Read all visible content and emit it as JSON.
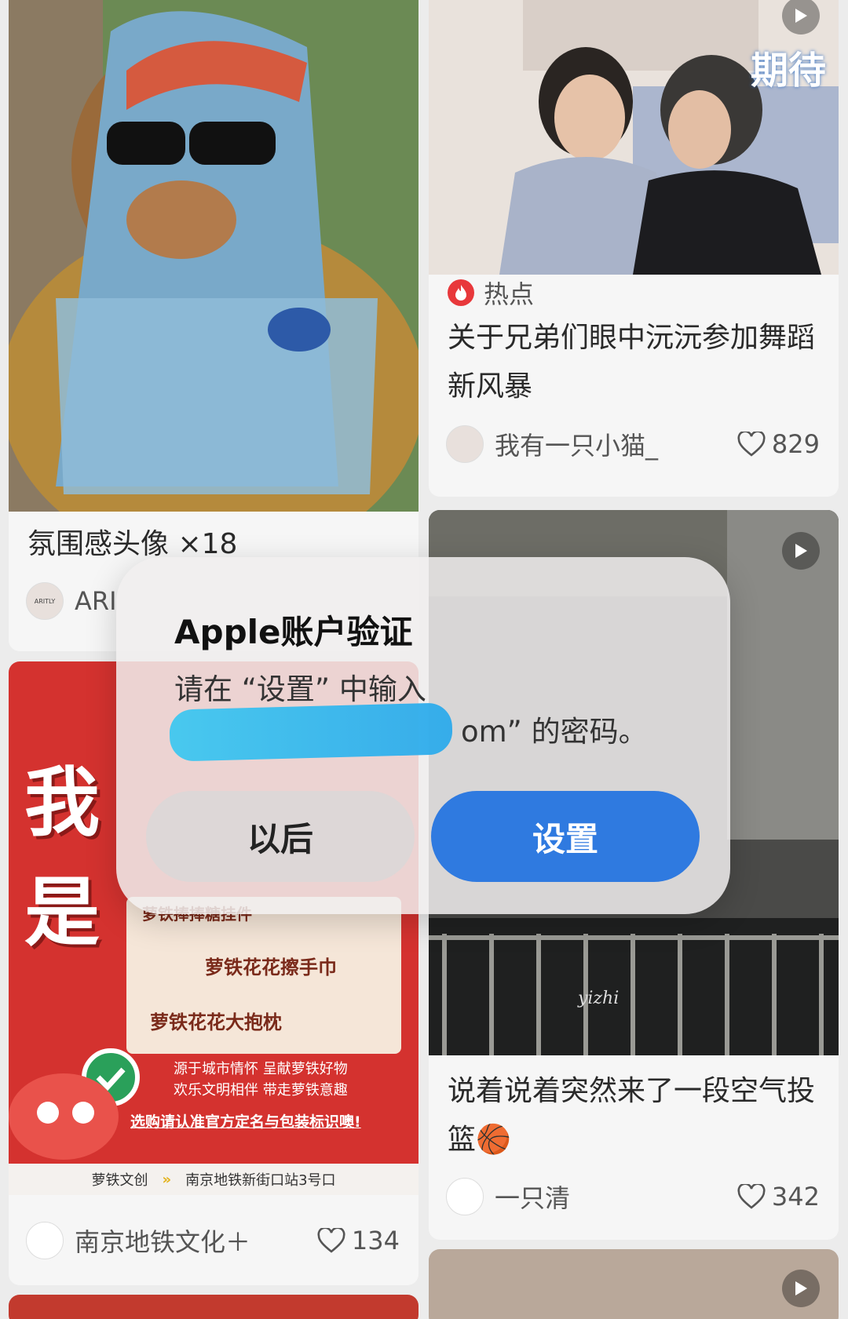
{
  "cards": [
    {
      "title": "氛围感头像 ×18",
      "author": "ARI",
      "avatar_text": "ARITLY"
    },
    {
      "badge": "热点",
      "title": "关于兄弟们眼中沅沅参加舞蹈新风暴",
      "author": "我有一只小猫_",
      "likes": "829",
      "overlay_text": "期待"
    },
    {
      "author": "南京地铁文化＋",
      "likes": "134",
      "poster": {
        "big": "我是",
        "items": [
          "萝铁捧捧糖挂件",
          "萝铁花花擦手巾",
          "萝铁花花大抱枕"
        ],
        "slogan1": "源于城市情怀  呈献萝铁好物",
        "slogan2": "欢乐文明相伴  带走萝铁意趣",
        "notice": "选购请认准官方定名与包装标识噢!",
        "footer_left": "萝铁文创",
        "footer_right": "南京地铁新街口站3号口"
      }
    },
    {
      "title": "说着说着突然来了一段空气投篮🏀",
      "author": "一只清",
      "likes": "342",
      "watermark": "yizhi"
    }
  ],
  "dialog": {
    "title": "Apple账户验证",
    "message_line1": "请在 “设置” 中输入",
    "message_line2": "om” 的密码。",
    "later_label": "以后",
    "settings_label": "设置"
  },
  "colors": {
    "accent": "#2f7ae0",
    "hot": "#e8383b",
    "redact": "#35b7ec"
  }
}
